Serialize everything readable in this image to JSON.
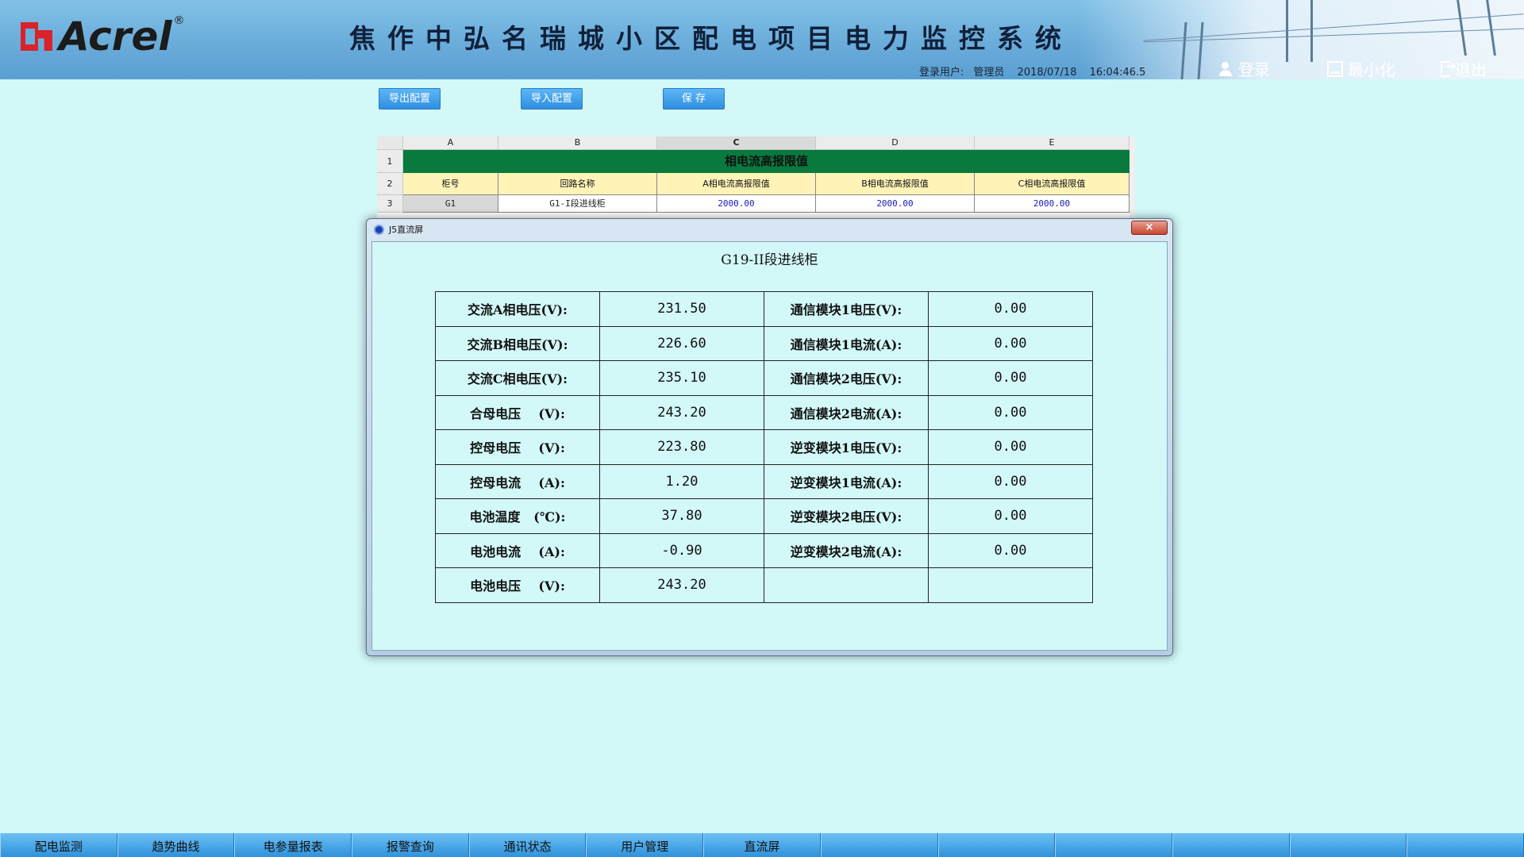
{
  "header": {
    "logo_text": "Acrel",
    "logo_reg": "®",
    "title": "焦作中弘名瑞城小区配电项目电力监控系统",
    "login_user_label": "登录用户:",
    "login_user": "管理员",
    "date": "2018/07/18",
    "time": "16:04:46.5",
    "buttons": {
      "login": "登录",
      "minimize": "最小化",
      "exit": "退出"
    }
  },
  "toolbar": {
    "export": "导出配置",
    "import": "导入配置",
    "save": "保 存"
  },
  "sheet": {
    "columns": [
      "A",
      "B",
      "C",
      "D",
      "E"
    ],
    "rows": [
      "1",
      "2",
      "3"
    ],
    "banner": "相电流高报限值",
    "headers": [
      "柜号",
      "回路名称",
      "A相电流高报限值",
      "B相电流高报限值",
      "C相电流高报限值"
    ],
    "row3": [
      "G1",
      "G1-I段进线柜",
      "2000.00",
      "2000.00",
      "2000.00"
    ]
  },
  "dialog": {
    "window_title": "J5直流屏",
    "close": "×",
    "heading": "G19-II段进线柜",
    "rows": [
      {
        "l1": "交流A相电压(V):",
        "v1": "231.50",
        "l2": "通信模块1电压(V):",
        "v2": "0.00"
      },
      {
        "l1": "交流B相电压(V):",
        "v1": "226.60",
        "l2": "通信模块1电流(A):",
        "v2": "0.00"
      },
      {
        "l1": "交流C相电压(V):",
        "v1": "235.10",
        "l2": "通信模块2电压(V):",
        "v2": "0.00"
      },
      {
        "l1": "合母电压    (V):",
        "v1": "243.20",
        "l2": "通信模块2电流(A):",
        "v2": "0.00"
      },
      {
        "l1": "控母电压    (V):",
        "v1": "223.80",
        "l2": "逆变模块1电压(V):",
        "v2": "0.00"
      },
      {
        "l1": "控母电流    (A):",
        "v1": "1.20",
        "l2": "逆变模块1电流(A):",
        "v2": "0.00"
      },
      {
        "l1": "电池温度   (℃):",
        "v1": "37.80",
        "l2": "逆变模块2电压(V):",
        "v2": "0.00"
      },
      {
        "l1": "电池电流    (A):",
        "v1": "-0.90",
        "l2": "逆变模块2电流(A):",
        "v2": "0.00"
      },
      {
        "l1": "电池电压    (V):",
        "v1": "243.20",
        "l2": "",
        "v2": ""
      }
    ]
  },
  "nav": [
    "配电监测",
    "趋势曲线",
    "电参量报表",
    "报警查询",
    "通讯状态",
    "用户管理",
    "直流屏",
    "",
    "",
    "",
    "",
    "",
    ""
  ]
}
